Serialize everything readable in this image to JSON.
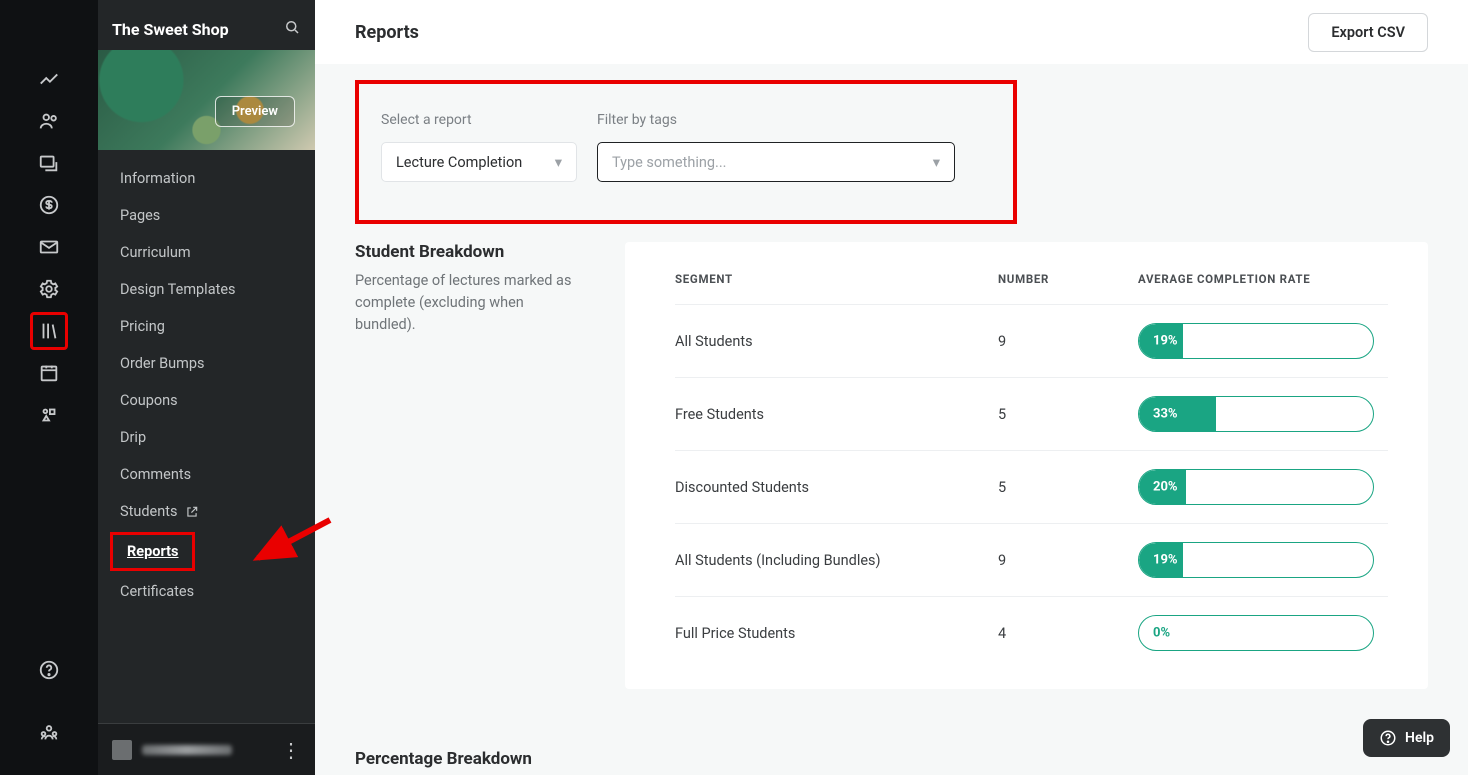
{
  "sidebar": {
    "title": "The Sweet Shop",
    "preview_label": "Preview",
    "items": [
      {
        "label": "Information"
      },
      {
        "label": "Pages"
      },
      {
        "label": "Curriculum"
      },
      {
        "label": "Design Templates"
      },
      {
        "label": "Pricing"
      },
      {
        "label": "Order Bumps"
      },
      {
        "label": "Coupons"
      },
      {
        "label": "Drip"
      },
      {
        "label": "Comments"
      },
      {
        "label": "Students",
        "external": true
      },
      {
        "label": "Reports",
        "active": true
      },
      {
        "label": "Certificates"
      }
    ]
  },
  "header": {
    "title": "Reports",
    "export_label": "Export CSV"
  },
  "filters": {
    "report_label": "Select a report",
    "report_value": "Lecture Completion",
    "tags_label": "Filter by tags",
    "tags_placeholder": "Type something..."
  },
  "breakdown": {
    "title": "Student Breakdown",
    "desc": "Percentage of lectures marked as complete (excluding when bundled).",
    "columns": {
      "segment": "SEGMENT",
      "number": "NUMBER",
      "rate": "AVERAGE COMPLETION RATE"
    }
  },
  "chart_data": {
    "type": "bar",
    "title": "Student Breakdown — Average Completion Rate",
    "xlabel": "Segment",
    "ylabel": "Average Completion Rate (%)",
    "ylim": [
      0,
      100
    ],
    "categories": [
      "All Students",
      "Free Students",
      "Discounted Students",
      "All Students (Including Bundles)",
      "Full Price Students"
    ],
    "series": [
      {
        "name": "Number",
        "values": [
          9,
          5,
          5,
          9,
          4
        ]
      },
      {
        "name": "Average Completion Rate (%)",
        "values": [
          19,
          33,
          20,
          19,
          0
        ]
      }
    ],
    "rows": [
      {
        "segment": "All Students",
        "number": "9",
        "pct": 19,
        "pct_label": "19%"
      },
      {
        "segment": "Free Students",
        "number": "5",
        "pct": 33,
        "pct_label": "33%"
      },
      {
        "segment": "Discounted Students",
        "number": "5",
        "pct": 20,
        "pct_label": "20%"
      },
      {
        "segment": "All Students (Including Bundles)",
        "number": "9",
        "pct": 19,
        "pct_label": "19%"
      },
      {
        "segment": "Full Price Students",
        "number": "4",
        "pct": 0,
        "pct_label": "0%"
      }
    ]
  },
  "section2": {
    "title": "Percentage Breakdown"
  },
  "help": {
    "label": "Help"
  }
}
